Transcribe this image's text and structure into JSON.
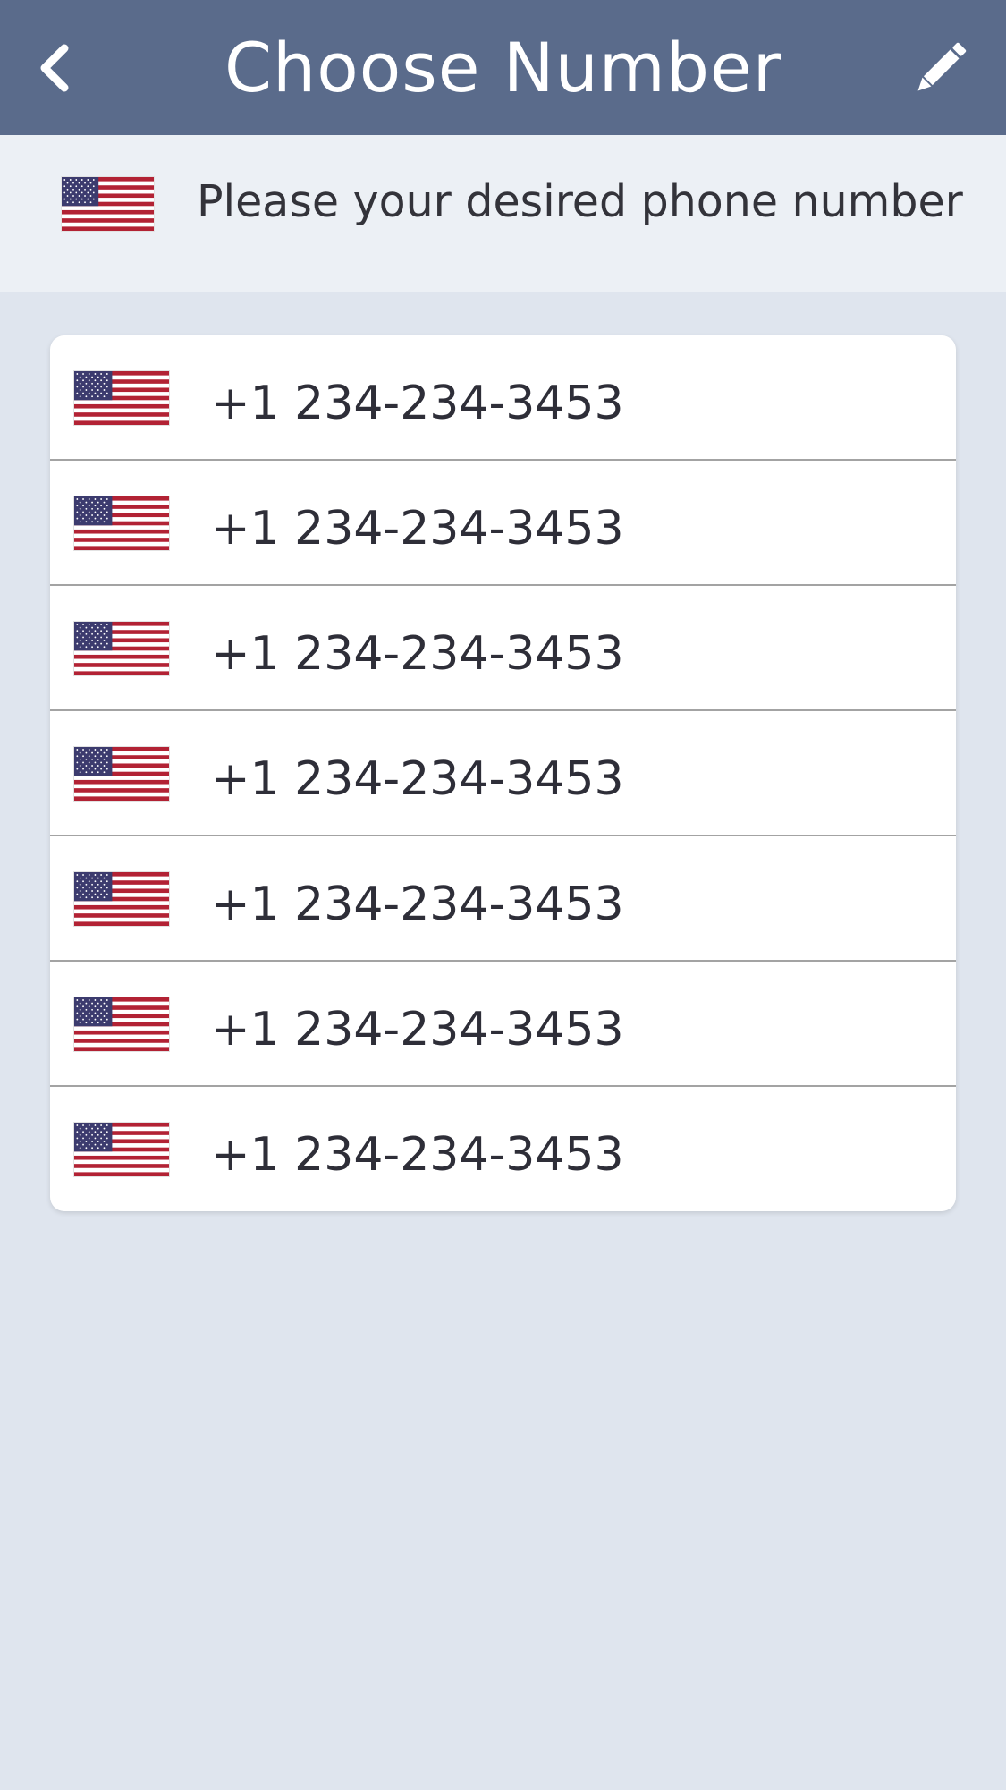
{
  "header": {
    "title": "Choose Number",
    "back_icon": "chevron-left-icon",
    "edit_icon": "pencil-icon"
  },
  "banner": {
    "flag_icon": "us-flag-icon",
    "text": "Please your desired phone number"
  },
  "numbers": [
    {
      "flag_icon": "us-flag-icon",
      "number": "+1 234-234-3453"
    },
    {
      "flag_icon": "us-flag-icon",
      "number": "+1 234-234-3453"
    },
    {
      "flag_icon": "us-flag-icon",
      "number": "+1 234-234-3453"
    },
    {
      "flag_icon": "us-flag-icon",
      "number": "+1 234-234-3453"
    },
    {
      "flag_icon": "us-flag-icon",
      "number": "+1 234-234-3453"
    },
    {
      "flag_icon": "us-flag-icon",
      "number": "+1 234-234-3453"
    },
    {
      "flag_icon": "us-flag-icon",
      "number": "+1 234-234-3453"
    }
  ],
  "colors": {
    "header_bg": "#5a6b8b",
    "banner_bg": "#ecf0f5",
    "page_bg": "#dfe5ee",
    "flag_red": "#b22234",
    "flag_blue": "#3c3b6e"
  }
}
